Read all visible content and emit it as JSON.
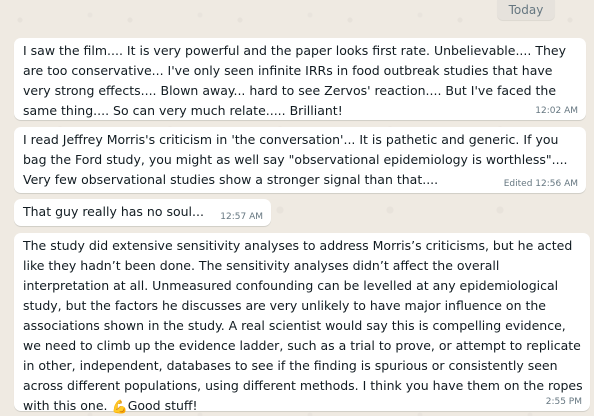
{
  "chat": {
    "date_label": "Today",
    "messages": [
      {
        "text": "I saw the film.... It is very powerful and the paper looks first rate. Unbelievable.... They are too conservative... I've only seen infinite IRRs in food outbreak studies that have very strong effects.... Blown away... hard to see Zervos' reaction.... But I've faced the same thing.... So can very much relate..... Brilliant!",
        "time": "12:02 AM"
      },
      {
        "text": "I read Jeffrey Morris's criticism in 'the conversation'... It is pathetic and generic. If you bag the Ford study, you might as well say \"observational epidemiology is worthless\".... Very few observational studies show a stronger signal than that....",
        "time": "Edited 12:56 AM"
      },
      {
        "text": "That guy really has no soul...",
        "time": "12:57 AM"
      },
      {
        "text": "The study did extensive sensitivity analyses to address Morris’s criticisms, but he acted like they hadn’t been done. The sensitivity analyses didn’t affect the overall interpretation at all. Unmeasured confounding can be levelled at any epidemiological study, but the factors he discusses are very unlikely to have major influence on the associations shown in the study. A real scientist would say this is compelling evidence, we need to climb up the evidence ladder, such as a trial to prove, or attempt to replicate in other, independent, databases to see if the finding is spurious or consistently seen across different populations, using different methods. I think you have them on the ropes with this one.",
        "emoji": "💪",
        "text_after_emoji": "Good stuff!",
        "time": "2:55 PM"
      }
    ]
  }
}
